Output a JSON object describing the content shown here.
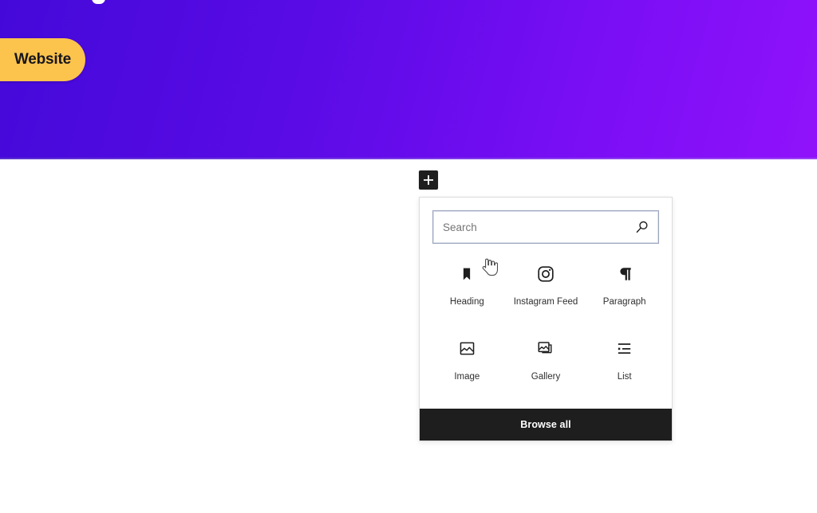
{
  "hero": {
    "cta_label": "Website",
    "cta_color": "#fcc34d",
    "gradient_from": "#4409d9",
    "gradient_to": "#9012fb"
  },
  "inserter": {
    "toggle_icon": "plus-icon",
    "toggle_title": "Toggle block inserter",
    "search": {
      "placeholder": "Search",
      "value": "",
      "icon": "search-icon"
    },
    "blocks": [
      {
        "label": "Heading",
        "icon": "heading-bookmark-icon"
      },
      {
        "label": "Instagram Feed",
        "icon": "instagram-icon"
      },
      {
        "label": "Paragraph",
        "icon": "pilcrow-icon"
      },
      {
        "label": "Image",
        "icon": "image-icon"
      },
      {
        "label": "Gallery",
        "icon": "gallery-icon"
      },
      {
        "label": "List",
        "icon": "list-icon"
      }
    ],
    "browse_all_label": "Browse all",
    "footer_color": "#1e1e1e"
  },
  "cursor": {
    "type": "pointing-hand-cursor"
  }
}
